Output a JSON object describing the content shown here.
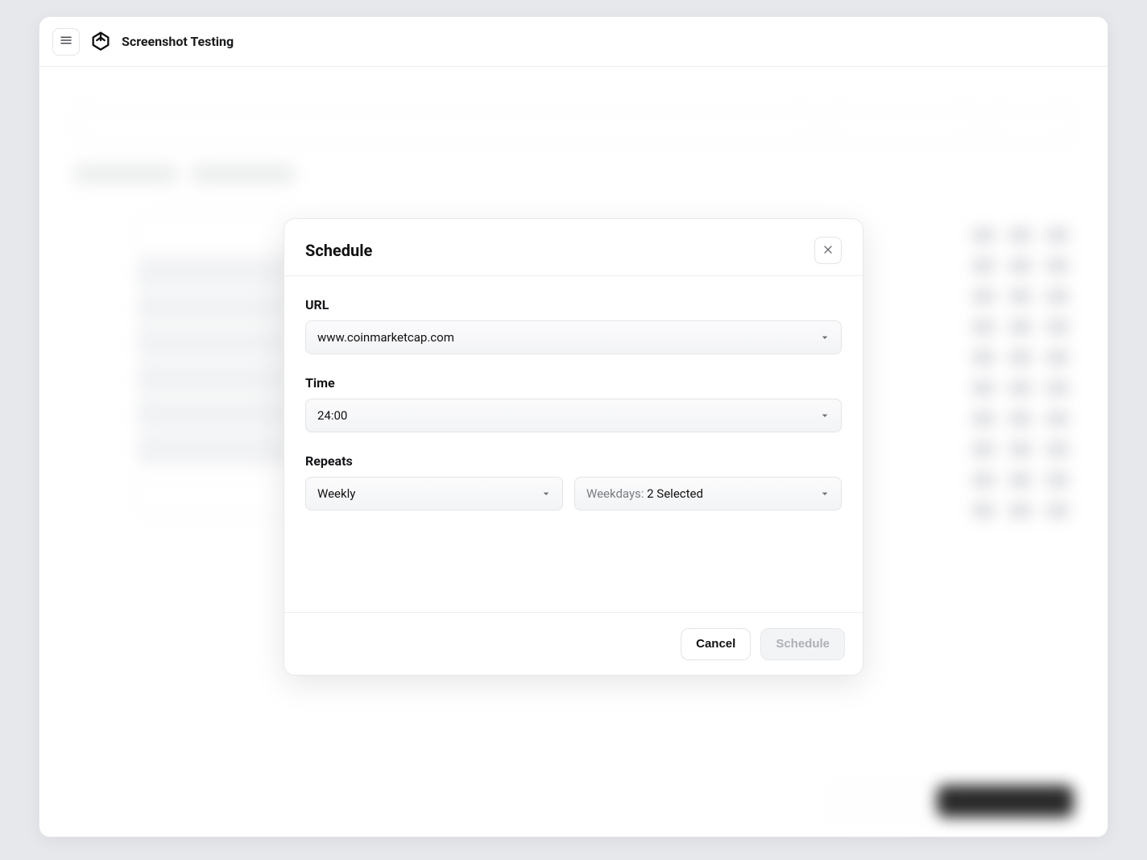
{
  "header": {
    "app_title": "Screenshot Testing"
  },
  "modal": {
    "title": "Schedule",
    "url_label": "URL",
    "url_value": "www.coinmarketcap.com",
    "time_label": "Time",
    "time_value": "24:00",
    "repeats_label": "Repeats",
    "repeats_value": "Weekly",
    "weekdays_prefix": "Weekdays: ",
    "weekdays_value": "2 Selected",
    "cancel_label": "Cancel",
    "submit_label": "Schedule"
  }
}
